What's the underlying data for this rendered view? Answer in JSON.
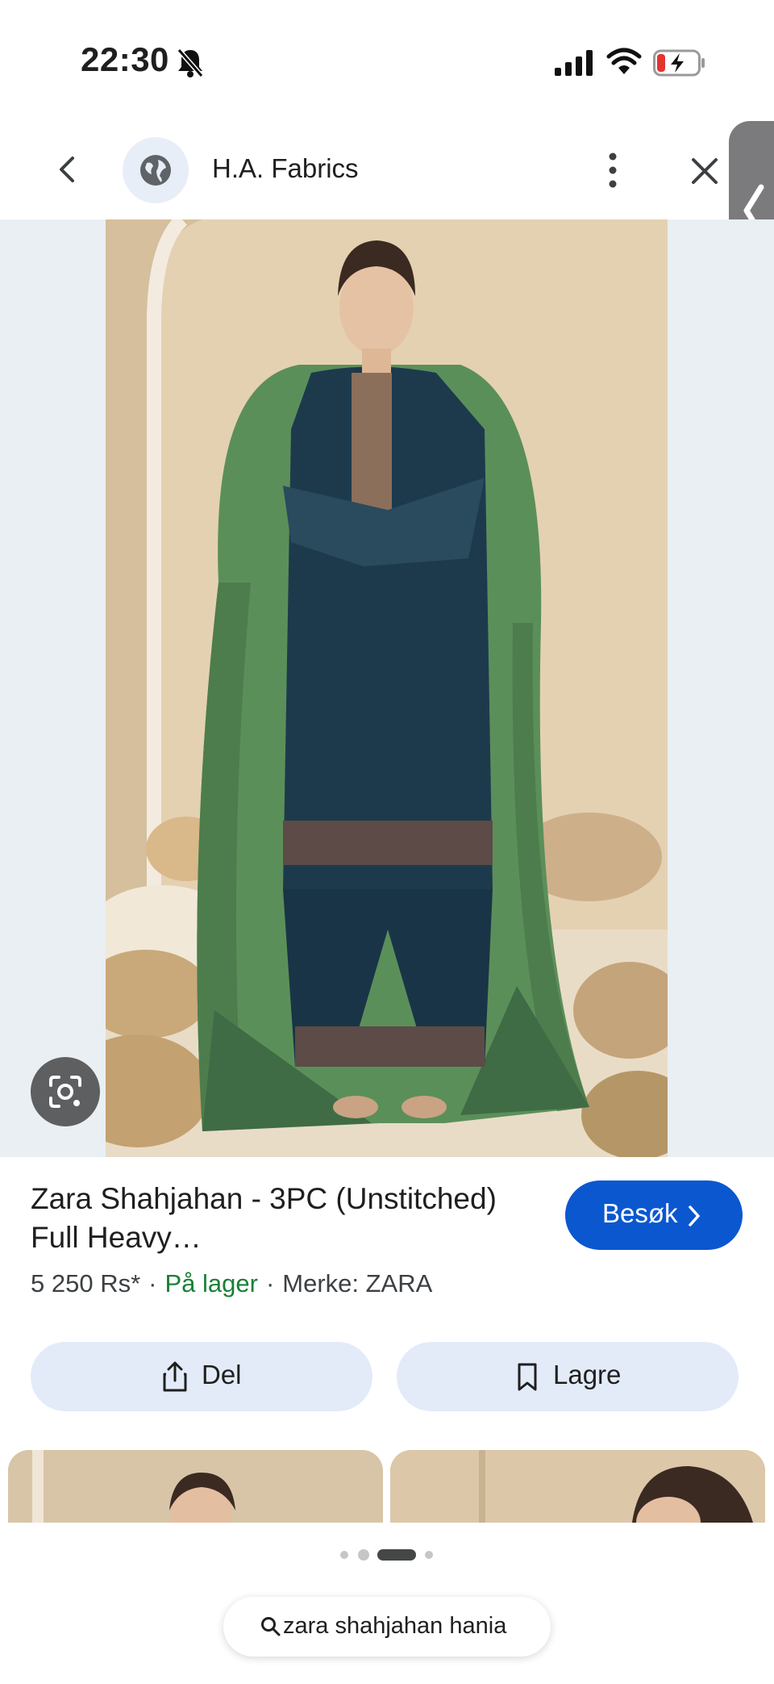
{
  "status_bar": {
    "time": "22:30",
    "battery_color": "#e3342f"
  },
  "header": {
    "site_name": "H.A. Fabrics",
    "icons": [
      "back-arrow-icon",
      "globe-icon",
      "more-vert-icon",
      "close-icon",
      "chevron-left-icon"
    ]
  },
  "product": {
    "title": "Zara Shahjahan - 3PC (Unstitched) Full Heavy…",
    "visit_label": "Besøk",
    "price": "5 250 Rs*",
    "availability": "På lager",
    "brand": "Merke: ZARA"
  },
  "actions": {
    "share_label": "Del",
    "save_label": "Lagre"
  },
  "search": {
    "query": "zara shahjahan hania"
  },
  "colors": {
    "accent": "#0b57d0",
    "stock": "#188038",
    "chip_bg": "#e3ebf9"
  }
}
